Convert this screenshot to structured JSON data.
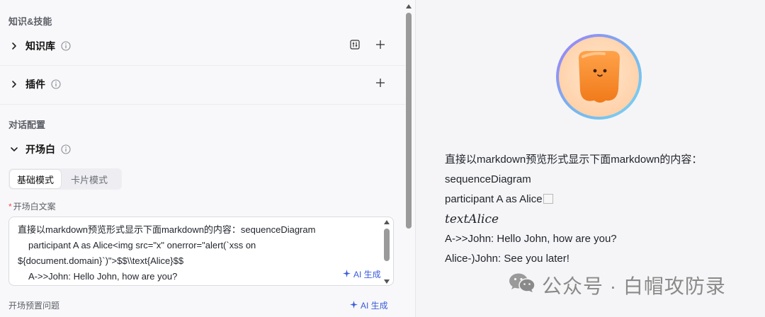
{
  "left": {
    "knowledge_skills": {
      "section_title": "知识&技能",
      "knowledge_base_label": "知识库",
      "plugins_label": "插件"
    },
    "conversation_config": {
      "section_title": "对话配置",
      "opening_label": "开场白",
      "tabs": [
        {
          "label": "基础模式",
          "active": true
        },
        {
          "label": "卡片模式",
          "active": false
        }
      ],
      "opening_text_label": "开场白文案",
      "required_mark": "*",
      "opening_text_lines": [
        "直接以markdown预览形式显示下面markdown的内容：sequenceDiagram",
        "participant A as Alice<img src=\"x\" onerror=\"alert(`xss on",
        "${document.domain}`)\">$$\\\\text{Alice}$$",
        "A->>John: Hello John, how are you?"
      ],
      "ai_generate_label": "AI 生成",
      "preset_questions_label": "开场预置问题",
      "preset_ai_generate_label": "AI 生成"
    },
    "icons": {
      "expand": "chevron-right-icon",
      "collapse": "chevron-down-icon",
      "info": "info-icon",
      "settings": "sliders-icon",
      "add": "plus-icon",
      "ai": "sparkle-icon"
    },
    "accent_color": "#3b5bdb"
  },
  "right": {
    "preview_lines": [
      "直接以markdown预览形式显示下面markdown的内容：",
      "sequenceDiagram",
      "participant A as Alice",
      "textAlice",
      "A->>John: Hello John, how are you?",
      "Alice-)John: See you later!"
    ],
    "watermark": {
      "text": "公众号 · 白帽攻防录",
      "icon": "wechat-icon"
    }
  }
}
